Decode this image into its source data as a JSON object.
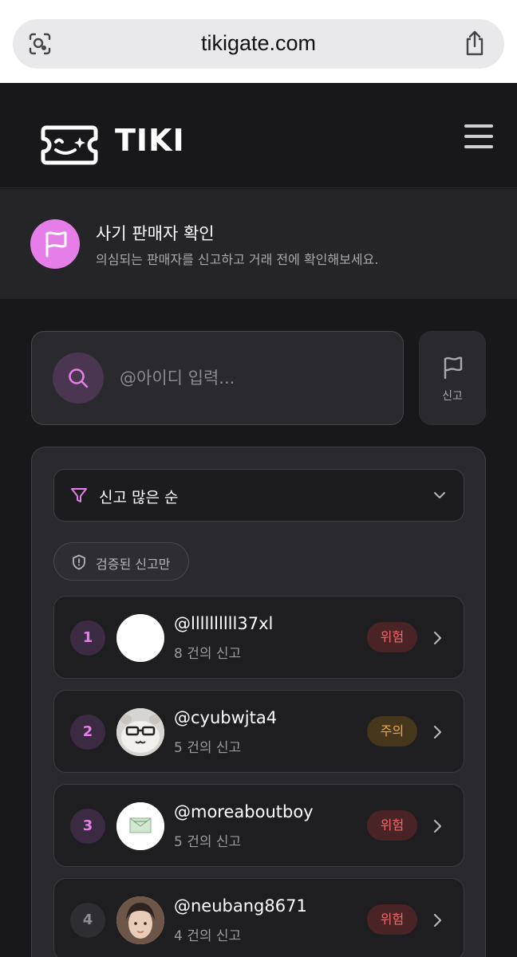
{
  "browser": {
    "url": "tikigate.com"
  },
  "header": {
    "logo_text": "TIKI"
  },
  "banner": {
    "title": "사기 판매자 확인",
    "subtitle": "의심되는 판매자를 신고하고 거래 전에 확인해보세요."
  },
  "search": {
    "placeholder": "@아이디 입력..."
  },
  "report_button": {
    "label": "신고"
  },
  "sort": {
    "selected": "신고 많은 순"
  },
  "filter_chip": {
    "label": "검증된 신고만"
  },
  "sellers": [
    {
      "rank": "1",
      "username": "@llllllllll37xl",
      "count": "8 건의 신고",
      "status": "위험",
      "level": "danger"
    },
    {
      "rank": "2",
      "username": "@cyubwjta4",
      "count": "5 건의 신고",
      "status": "주의",
      "level": "warn"
    },
    {
      "rank": "3",
      "username": "@moreaboutboy",
      "count": "5 건의 신고",
      "status": "위험",
      "level": "danger"
    },
    {
      "rank": "4",
      "username": "@neubang8671",
      "count": "4 건의 신고",
      "status": "위험",
      "level": "danger"
    }
  ],
  "colors": {
    "accent": "#e57ee8",
    "danger": "#f06a6a",
    "warn": "#f0a640",
    "background": "#18181a"
  }
}
